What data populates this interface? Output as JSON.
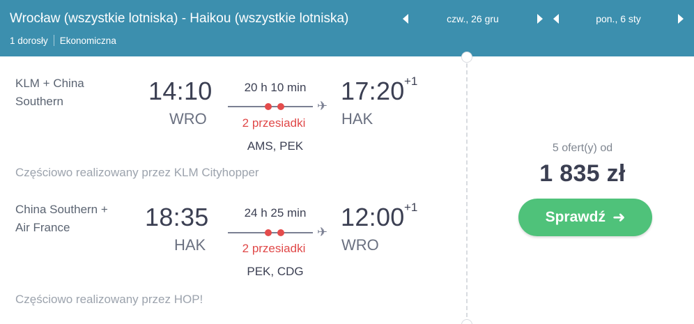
{
  "header": {
    "route": "Wrocław (wszystkie lotniska) - Haikou (wszystkie lotniska)",
    "passengers": "1 dorosły",
    "cabin": "Ekonomiczna",
    "depart_date": "czw., 26 gru",
    "return_date": "pon., 6 sty",
    "bg_color": "#3c8fae"
  },
  "outbound": {
    "carrier": "KLM + China Southern",
    "depart_time": "14:10",
    "depart_code": "WRO",
    "duration": "20 h 10 min",
    "stops": "2 przesiadki",
    "via": "AMS, PEK",
    "arrive_time": "17:20",
    "arrive_day_offset": "+1",
    "arrive_code": "HAK",
    "operated_by": "Częściowo realizowany przez KLM Cityhopper"
  },
  "inbound": {
    "carrier": "China Southern + Air France",
    "depart_time": "18:35",
    "depart_code": "HAK",
    "duration": "24 h 25 min",
    "stops": "2 przesiadki",
    "via": "PEK, CDG",
    "arrive_time": "12:00",
    "arrive_day_offset": "+1",
    "arrive_code": "WRO",
    "operated_by": "Częściowo realizowany przez HOP!"
  },
  "pricing": {
    "offers": "5 ofert(y) od",
    "price": "1 835 zł",
    "button_label": "Sprawdź",
    "button_color": "#4fc27a"
  },
  "icons": {
    "plane": "airplane-icon",
    "arrow": "arrow-right-icon",
    "prev": "triangle-left-icon",
    "next": "triangle-right-icon"
  }
}
